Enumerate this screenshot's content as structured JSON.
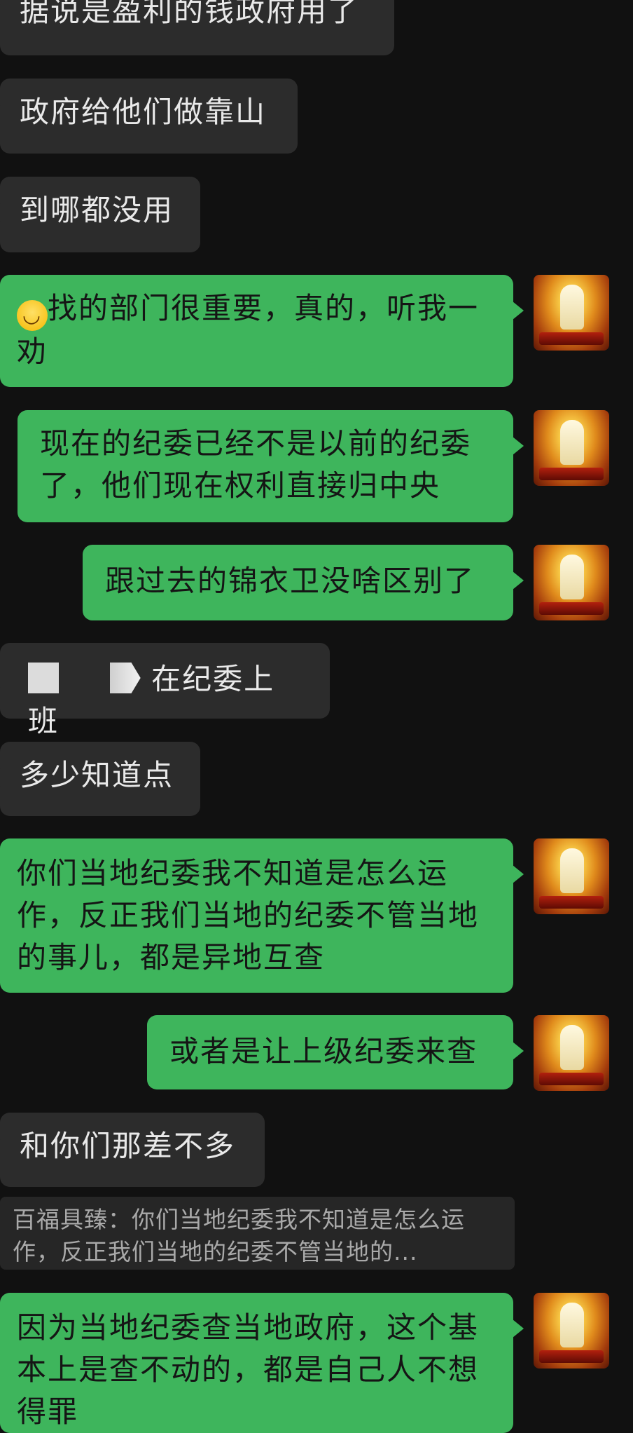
{
  "messages": [
    {
      "id": "m1",
      "side": "received",
      "text": "据说是盈利的钱政府用了"
    },
    {
      "id": "m2",
      "side": "received",
      "text": "政府给他们做靠山"
    },
    {
      "id": "m3",
      "side": "received",
      "text": "到哪都没用"
    },
    {
      "id": "m4",
      "side": "sent",
      "emoji": "😂",
      "text": "找的部门很重要，真的，听我一劝"
    },
    {
      "id": "m5",
      "side": "sent",
      "text": "现在的纪委已经不是以前的纪委了，他们现在权利直接归中央"
    },
    {
      "id": "m6",
      "side": "sent",
      "text": "跟过去的锦衣卫没啥区别了"
    },
    {
      "id": "m7",
      "side": "received",
      "text": "在纪委上班",
      "redacted": true
    },
    {
      "id": "m8",
      "side": "received",
      "text": "多少知道点"
    },
    {
      "id": "m9",
      "side": "sent",
      "text": "你们当地纪委我不知道是怎么运作，反正我们当地的纪委不管当地的事儿，都是异地互查"
    },
    {
      "id": "m10",
      "side": "sent",
      "text": "或者是让上级纪委来查"
    },
    {
      "id": "m11",
      "side": "received",
      "text": "和你们那差不多"
    },
    {
      "id": "m12",
      "side": "sent",
      "text": "因为当地纪委查当地政府，这个基本上是查不动的，都是自己人不想得罪"
    }
  ],
  "quote": {
    "text": "百福具臻：你们当地纪委我不知道是怎么运作，反正我们当地的纪委不管当地的..."
  },
  "colors": {
    "background": "#111111",
    "sent_bubble": "#3eb55c",
    "received_bubble": "#2c2c2c"
  },
  "avatar": {
    "icon": "golden-buddha-avatar-icon"
  }
}
